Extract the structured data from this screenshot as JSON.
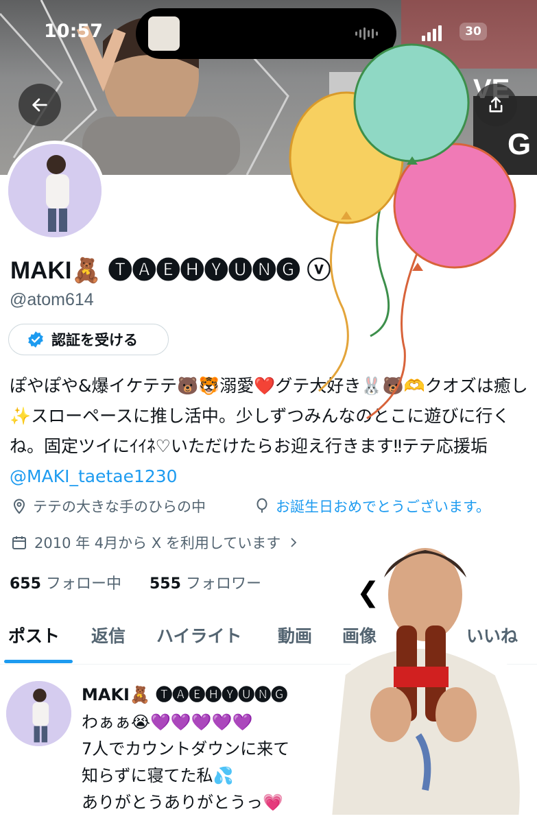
{
  "status_bar": {
    "time": "10:57",
    "battery": "30"
  },
  "banner": {
    "sign_text_1": "VE",
    "sign_text_2": "G"
  },
  "header": {
    "back_icon": "arrow-left-icon",
    "share_icon": "share-icon"
  },
  "profile": {
    "display_name": "MAKI🧸 🅣🅐🅔🅗🅨🅤🅝🅖 ⓥ",
    "handle": "@atom614",
    "verify_button": "認証を受ける",
    "bio_text": "ぽやぽや&爆イケテテ🐻🐯溺愛❤️グテ大好き🐰🐻🫶クオズは癒し✨スローペースに推し活中。少しずつみんなのとこに遊びに行くね。固定ツイにｲｲﾈ♡いただけたらお迎え行きます‼︎テテ応援垢",
    "bio_mention": "@MAKI_taetae1230",
    "location": "テテの大きな手のひらの中",
    "birthday": "お誕生日おめでとうございます。",
    "joined": "2010 年 4月から X を利用しています",
    "following_count": "655",
    "following_label": "フォロー中",
    "followers_count": "555",
    "followers_label": "フォロワー"
  },
  "tabs": [
    {
      "label": "ポスト"
    },
    {
      "label": "返信"
    },
    {
      "label": "ハイライト"
    },
    {
      "label": "動画"
    },
    {
      "label": "画像"
    },
    {
      "label": "いいね"
    }
  ],
  "post": {
    "name": "MAKI🧸 🅣🅐🅔🅗🅨🅤🅝🅖",
    "line1": "わぁぁ😭💜💜💜💜💜",
    "line2": "7人でカウントダウンに来て",
    "line3": "知らずに寝てた私💦",
    "line4": "ありがとうありがとうっ💗"
  },
  "colors": {
    "accent": "#1d9bf0",
    "text": "#0f1419",
    "muted": "#536471"
  }
}
